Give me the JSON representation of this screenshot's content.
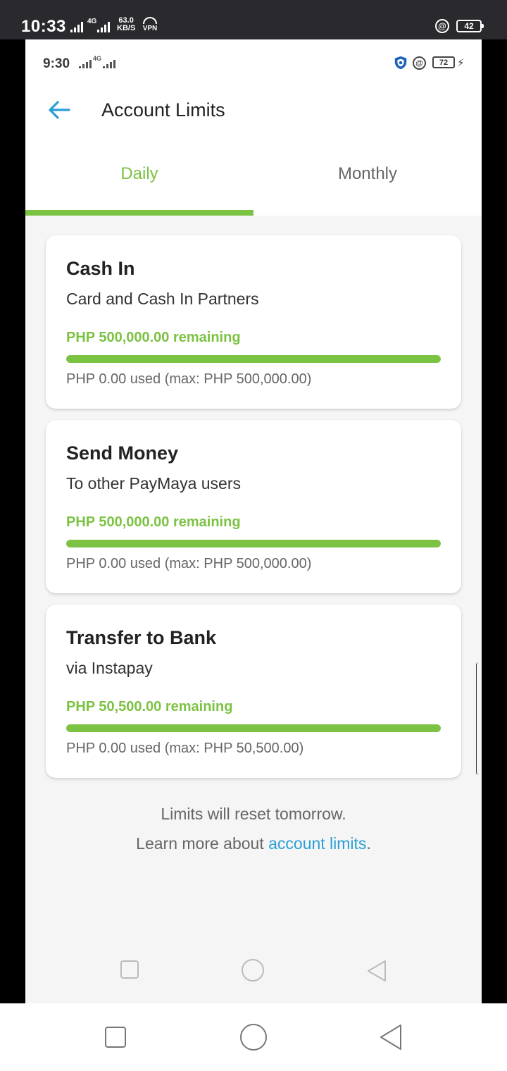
{
  "outer_status": {
    "time": "10:33",
    "network_label": "4G",
    "speed_value": "63.0",
    "speed_unit": "KB/S",
    "vpn_label": "VPN",
    "at_symbol": "@",
    "battery": "42"
  },
  "inner_status": {
    "time": "9:30",
    "network_label": "4G",
    "at_symbol": "@",
    "battery": "72",
    "charging_symbol": "⚡"
  },
  "header": {
    "title": "Account Limits"
  },
  "tabs": [
    {
      "label": "Daily",
      "active": true
    },
    {
      "label": "Monthly",
      "active": false
    }
  ],
  "limits": [
    {
      "title": "Cash In",
      "subtitle": "Card and Cash In Partners",
      "remaining_text": "PHP 500,000.00 remaining",
      "used_text": "PHP 0.00 used (max: PHP 500,000.00)",
      "remaining_fraction": 1.0
    },
    {
      "title": "Send Money",
      "subtitle": "To other PayMaya users",
      "remaining_text": "PHP 500,000.00 remaining",
      "used_text": "PHP 0.00 used (max: PHP 500,000.00)",
      "remaining_fraction": 1.0
    },
    {
      "title": "Transfer to Bank",
      "subtitle": "via Instapay",
      "remaining_text": "PHP 50,500.00 remaining",
      "used_text": "PHP 0.00 used (max: PHP 50,500.00)",
      "remaining_fraction": 1.0
    }
  ],
  "footer": {
    "reset_note": "Limits will reset tomorrow.",
    "learn_prefix": "Learn more about ",
    "learn_link": "account limits",
    "learn_suffix": "."
  },
  "colors": {
    "accent_green": "#7cc243",
    "link_blue": "#2a9fd6"
  },
  "icons": {
    "back": "arrow-left-icon",
    "recents": "square-icon",
    "home": "circle-icon",
    "back_nav": "triangle-back-icon"
  }
}
